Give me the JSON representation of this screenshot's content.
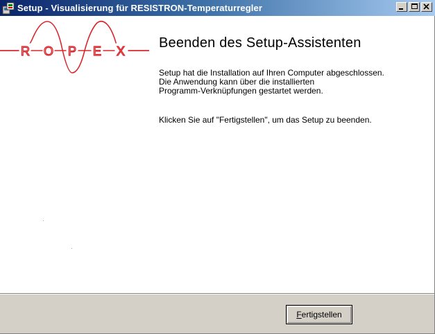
{
  "window": {
    "title": "Setup - Visualisierung für RESISTRON-Temperaturregler",
    "minimize_glyph": "_",
    "maximize_glyph": "□",
    "close_glyph": "×"
  },
  "logo": {
    "letters": [
      "R",
      "O",
      "P",
      "E",
      "X"
    ],
    "color": "#d9262c"
  },
  "content": {
    "heading": "Beenden des Setup-Assistenten",
    "paragraph1": [
      "Setup hat die Installation auf Ihren Computer abgeschlossen.",
      "Die Anwendung kann über die installierten",
      "Programm-Verknüpfungen gestartet werden."
    ],
    "paragraph2": "Klicken Sie auf \"Fertigstellen\", um das Setup zu beenden."
  },
  "footer": {
    "finish_button_mnemonic": "F",
    "finish_button_rest": "ertigstellen"
  },
  "colors": {
    "titlebar_start": "#0a246a",
    "titlebar_end": "#a6caf0",
    "panel": "#d4d0c8"
  }
}
